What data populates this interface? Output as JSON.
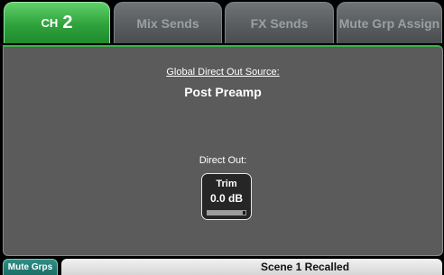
{
  "tabs": {
    "ch_prefix": "CH",
    "ch_number": "2",
    "mix_sends": "Mix Sends",
    "fx_sends": "FX Sends",
    "mute_grp_assign": "Mute Grp Assign"
  },
  "panel": {
    "global_direct_out_label": "Global Direct Out Source:",
    "global_direct_out_value": "Post Preamp",
    "direct_out_label": "Direct Out:",
    "trim": {
      "title": "Trim",
      "value": "0.0 dB",
      "level_fraction": 0.92
    }
  },
  "status": {
    "mute_grps_button": "Mute Grps",
    "message": "Scene 1 Recalled"
  },
  "colors": {
    "active_tab": "#2fa23c",
    "inactive_tab": "#595d5f",
    "panel_bg": "#5b5b5b",
    "mute_grps_bg": "#1b6e66"
  }
}
